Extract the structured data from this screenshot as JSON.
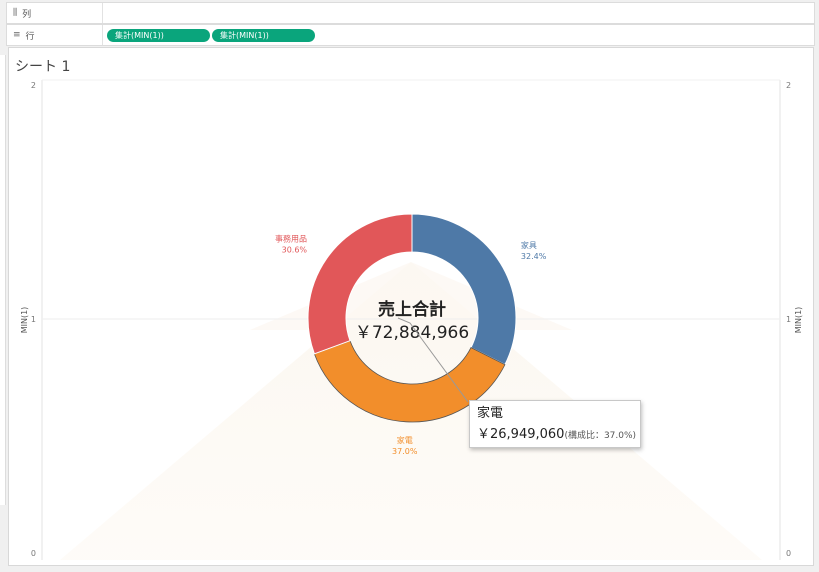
{
  "shelves": {
    "columns": {
      "icon": "columns-icon",
      "glyph": "⫼",
      "label": "列",
      "pills": []
    },
    "rows": {
      "icon": "rows-icon",
      "glyph": "≡",
      "label": "行",
      "pills": [
        "集計(MIN(1))",
        "集計(MIN(1))"
      ],
      "pill_color": "#0aa57c"
    }
  },
  "sheet": {
    "title": "シート 1"
  },
  "axes": {
    "left_label": "MIN(1)",
    "right_label": "MIN(1)",
    "ticks": [
      "2",
      "1",
      "0"
    ]
  },
  "center": {
    "title": "売上合計",
    "total": "￥72,884,966"
  },
  "tooltip": {
    "title": "家電",
    "value": "￥26,949,060",
    "note": "(構成比：37.0%)"
  },
  "colors": {
    "furniture": "#4e79a7",
    "appliances": "#f28e2b",
    "office": "#e15759",
    "gridline": "#eeeeee"
  },
  "chart_data": {
    "type": "pie",
    "variant": "donut",
    "total": 72884966,
    "center_label": "売上合計",
    "center_value": "￥72,884,966",
    "slices": [
      {
        "label": "家具",
        "percent": 32.4,
        "percent_text": "32.4%",
        "color": "#4e79a7"
      },
      {
        "label": "家電",
        "percent": 37.0,
        "percent_text": "37.0%",
        "color": "#f28e2b",
        "value": 26949060
      },
      {
        "label": "事務用品",
        "percent": 30.6,
        "percent_text": "30.6%",
        "color": "#e15759"
      }
    ],
    "ylabel": "MIN(1)",
    "ylim": [
      0,
      2
    ],
    "yticks": [
      0,
      1,
      2
    ]
  }
}
